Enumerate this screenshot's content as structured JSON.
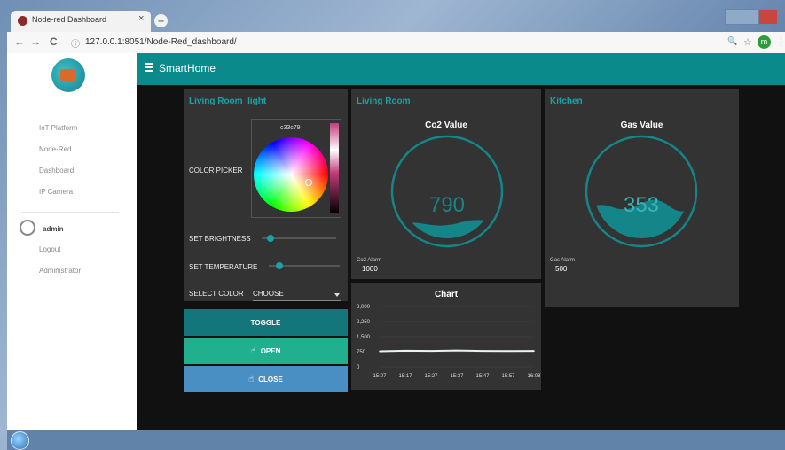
{
  "browser": {
    "tab_title": "Node-red Dashboard",
    "tab_close": "×",
    "new_tab": "+",
    "url_text": "127.0.0.1:8051/Node-Red_dashboard/",
    "profile_initial": "m",
    "nav": {
      "back": "←",
      "forward": "→",
      "reload": "C",
      "info": "ⓘ"
    },
    "right_icons": {
      "zoom": "🔍",
      "star": "☆",
      "menu": "⋮"
    }
  },
  "sidebar": {
    "items": [
      "IoT Platform",
      "Node-Red",
      "Dashboard",
      "IP Camera"
    ],
    "user": "admin",
    "user_items": [
      "Logout",
      "Administrator"
    ]
  },
  "header": {
    "title": "SmartHome"
  },
  "light_panel": {
    "title": "Living Room_light",
    "color_picker_label": "COLOR PICKER",
    "color_hex": "c33c79",
    "brightness_label": "SET BRIGHTNESS",
    "brightness_level": 0.12,
    "temperature_label": "SET TEMPERATURE",
    "temperature_level": 0.15,
    "select_label": "SELECT COLOR",
    "select_value": "CHOOSE",
    "toggle_label": "TOGGLE",
    "open_label": "OPEN",
    "close_label": "CLOSE"
  },
  "living_room": {
    "title": "Living Room",
    "gauge_title": "Co2 Value",
    "gauge_value": "790",
    "alarm_label": "Co2 Alarm",
    "alarm_value": "1000",
    "chart_title": "Chart"
  },
  "kitchen": {
    "title": "Kitchen",
    "gauge_title": "Gas Value",
    "gauge_value": "353",
    "alarm_label": "Gas Alarm",
    "alarm_value": "500"
  },
  "colors": {
    "accent": "#1aa3a6",
    "header": "#0b8a8c",
    "toggle": "#12767a",
    "open": "#21b08e",
    "close": "#4a8fc4",
    "panel": "#333333"
  },
  "chart_data": {
    "type": "line",
    "title": "Chart",
    "categories": [
      "15:07",
      "15:17",
      "15:27",
      "15:37",
      "15:47",
      "15:57",
      "16:08"
    ],
    "series": [
      {
        "values": [
          770,
          800,
          790,
          810,
          790,
          785,
          790
        ]
      }
    ],
    "yticks": [
      "3,000",
      "2,250",
      "1,500",
      "750",
      "0"
    ],
    "ylim": [
      0,
      3000
    ],
    "grid": true
  }
}
